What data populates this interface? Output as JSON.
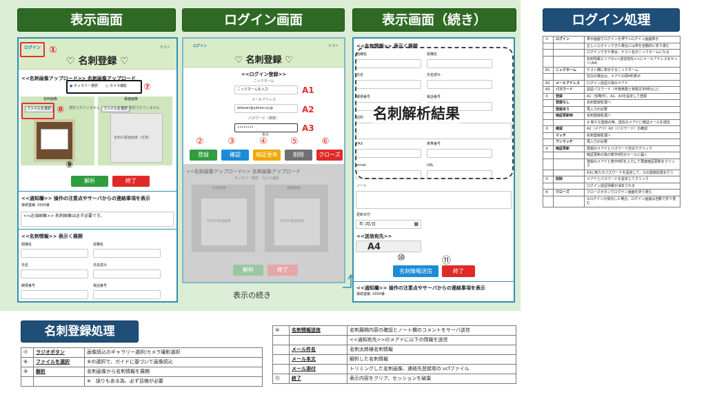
{
  "headers": {
    "display": "表示画面",
    "login": "ログイン画面",
    "display_cont": "表示画面（続き）",
    "login_proc": "ログイン処理",
    "meishi_proc": "名刺登録処理"
  },
  "p1": {
    "login": "ログイン",
    "guest": "ゲスト",
    "title": "♡ 名刺登録 ♡",
    "upload_head": "<<名刺画像アップロード>> 名刺画像アップロード",
    "radio_gallery": "ギャラリー選択",
    "radio_camera": "カメラ撮影",
    "card_label": "名刺画像",
    "back_label": "裏面画像",
    "file_btn": "ファイルを選択",
    "no_file": "選択されていません",
    "back_ph": "名刺の裏面画像（任意）",
    "parse_btn": "解析",
    "end_btn": "終了",
    "notice_head": "<<通知欄>> 操作の注意点やサーバからの連絡事項を表示",
    "notice_count": "接続連番: 0000番",
    "notice_body": "<<必須画像>> 名刺画像は必ず必要です。",
    "info_head": "<<名刺情報>> 表示く展開",
    "f_company": "組織名",
    "f_position": "役職名",
    "f_name": "氏名",
    "f_kana": "氏名読み",
    "f_zip": "郵便番号",
    "f_tel": "電話番号"
  },
  "p2": {
    "login": "ログイン",
    "guest": "ゲスト",
    "title": "♡ 名刺登録 ♡",
    "login_head": "<<ログイン登録>>",
    "nick_label": "ニックネーム",
    "nick_ph": "ニックネームを入力",
    "mail_label": "メールアドレス",
    "mail_val": "aitasan@yahoo.co.jp",
    "pw_label": "パスワード（英数）",
    "pw_val": "••••••••",
    "pw_show": "表示",
    "b_register": "登録",
    "b_confirm": "確認",
    "b_auth": "暗証更新",
    "b_delete": "削除",
    "b_close": "クローズ",
    "upload_head": "<<名刺画像アップロード>> 名刺画像アップロード",
    "radio": "ギャラリー選択　カメラ撮影",
    "card_label": "名刺画像",
    "back_label": "裏面画像",
    "file_btn": "ファイルを選択",
    "no_file": "選択されていません",
    "card_ph": "名刺の表面画像",
    "back_ph": "名刺の裏面画像",
    "parse_btn": "解析",
    "end_btn": "終了"
  },
  "p3": {
    "head": "<<名刺情報>> 表示く展開",
    "company": "組織名",
    "position": "役職名",
    "name": "氏名",
    "kana": "氏名読み",
    "zip": "郵便番号",
    "tel": "電話番号",
    "address": "住所",
    "fax": "FAX",
    "mobile": "携帯番号",
    "email": "email",
    "url": "URL",
    "overlay": "名刺解析結果",
    "note": "ノート",
    "date_label": "更新日付",
    "date_val": "年 /月/日",
    "dest_head": "<<送信宛先>>",
    "a4": "A4",
    "send_btn": "名刺情報送信",
    "end_btn": "終了",
    "notice_head": "<<通知欄>> 操作の注意点やサーバからの連絡事項を表示",
    "notice_count": "接続連番: 0000番"
  },
  "markers": {
    "m1": "①",
    "m2": "②",
    "m3": "③",
    "m4": "④",
    "m5": "⑤",
    "m6": "⑥",
    "m7": "⑦",
    "m8": "⑧",
    "m9": "⑨",
    "m10": "⑩",
    "m11": "⑪",
    "a1": "A1",
    "a2": "A2",
    "a3": "A3",
    "a4": "A4"
  },
  "caption": "表示の続き",
  "right_rows": [
    [
      "①",
      "ログイン",
      "表示画面でログインを押下⇒ログイン画面表示"
    ],
    [
      "",
      "",
      "正しくログインできた場合には枠を自動的に折り畳む"
    ],
    [
      "",
      "",
      "ログインできた場合、ゲスト名がニックネームになる"
    ],
    [
      "",
      "",
      "名刺情報エリアの<<送信宛先>>にメールアドレスをセット(A4)"
    ],
    [
      "A1",
      "ニックネーム",
      "ゲスト欄に表示するニックネーム"
    ],
    [
      "",
      "",
      "空白の場合は、メアドの頭4桁表示"
    ],
    [
      "A2",
      "メールアドレス",
      "ログイン認証の為のメアド"
    ],
    [
      "A3",
      "パスワード",
      "認証パスワード（半角英数と特殊文字8桁以上）"
    ],
    [
      "②",
      "登録",
      "A1（省略可）、A2、A3を設定して登録"
    ],
    [
      "",
      "登録なし",
      "名刺登録処理へ"
    ],
    [
      "",
      "登録あり",
      "再入力が必要"
    ],
    [
      "",
      "暗証更新時",
      "名刺登録処理へ"
    ],
    [
      "",
      "",
      "※ 新たな登録の時、送信のメアドに暗証メールを送信"
    ],
    [
      "③",
      "確認",
      "A2（メアド）A3（パスワード）の確認"
    ],
    [
      "",
      "マッチ",
      "名刺登録処理へ"
    ],
    [
      "",
      "アンマッチ",
      "再入力が必要"
    ],
    [
      "④",
      "暗証更新",
      "登録のメアドとパスワード空白でクリック"
    ],
    [
      "",
      "",
      "暗証更新の為の数字8桁がメールに届く"
    ],
    [
      "",
      "",
      "登録のメアドと数字8桁を入力して再度暗証更新をクリック"
    ],
    [
      "",
      "",
      "A3に新たなパスワードを設定して、②の登録処理を行う"
    ],
    [
      "⑤",
      "削除",
      "メアドとパスワードを設定してクリック"
    ],
    [
      "",
      "",
      "ログイン認証情報が消去される"
    ],
    [
      "⑥",
      "クローズ",
      "クローズボタンでログイン画面を折り畳む"
    ],
    [
      "",
      "",
      "※ログインが成功した場合、ログイン画面は自動で折り畳む"
    ]
  ],
  "bl_rows": [
    [
      "⑦",
      "ラジオボタン",
      "画像読込のギャラリー選択/カメラ撮影選択"
    ],
    [
      "⑧",
      "ファイルを選択",
      "⑧の選択で、ガイドに基づいて画像読込"
    ],
    [
      "⑨",
      "解析",
      "名刺画像から名刺情報を展開"
    ],
    [
      "",
      "",
      "※　誤りもある為、必ず目検が必要"
    ]
  ],
  "bm_rows": [
    [
      "⑩",
      "名刺情報送信",
      "名刺展開内容の確認とノート欄のコメントをサーバ送信"
    ],
    [
      "",
      "",
      "<<通知宛先>>のメアドに以下の情報を送信"
    ],
    [
      "",
      "メール件名",
      "名刺太郎様名刺情報"
    ],
    [
      "",
      "メール本文",
      "解析した名刺情報"
    ],
    [
      "",
      "メール添付",
      "トリミングした名刺画像、連絡先登録用の.vcfファイル"
    ],
    [
      "⑪",
      "終了",
      "表示内容をクリア、セッションを破棄"
    ]
  ],
  "colors": {
    "header_green": "#2e6a24",
    "panel_border": "#2f8fae",
    "panel_top": "#d8edc7",
    "bg_green": "#dcedd5",
    "marker_red": "#e62e2e",
    "navy": "#1f4e79",
    "btn_green": "#2e9e3e",
    "btn_red": "#e02a2a",
    "btn_blue": "#1e8bd6",
    "btn_yellow": "#f0a800",
    "btn_gray": "#707070"
  }
}
